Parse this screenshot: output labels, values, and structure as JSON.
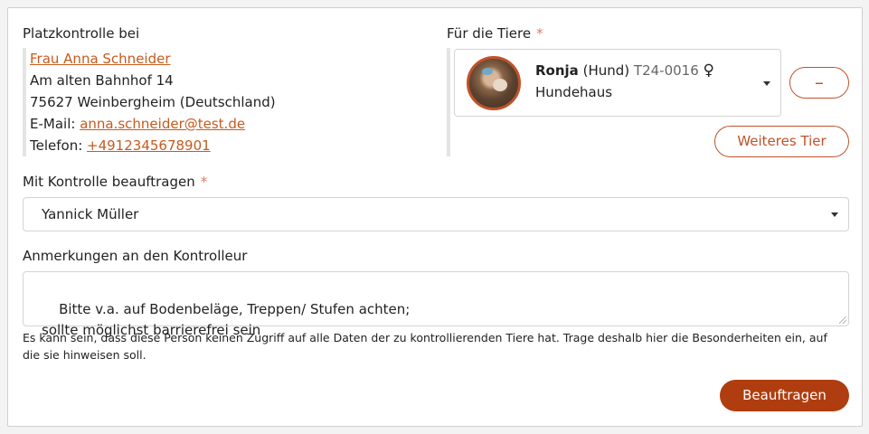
{
  "left": {
    "heading": "Platzkontrolle bei",
    "name": "Frau Anna Schneider",
    "street": "Am alten Bahnhof 14",
    "city": "75627 Weinbergheim (Deutschland)",
    "email_label": "E-Mail: ",
    "email": "anna.schneider@test.de",
    "phone_label": "Telefon: ",
    "phone": "+4912345678901"
  },
  "animals": {
    "heading": "Für die Tiere",
    "required_mark": "*",
    "items": [
      {
        "name": "Ronja",
        "species": "(Hund)",
        "id": "T24-0016",
        "sex_icon": "female-icon",
        "sex_glyph": "♀",
        "location": "Hundehaus"
      }
    ],
    "remove_label": "–",
    "add_label": "Weiteres Tier"
  },
  "assign": {
    "label": "Mit Kontrolle beauftragen",
    "required_mark": "*",
    "value": "Yannick Müller"
  },
  "notes": {
    "label": "Anmerkungen an den Kontrolleur",
    "value": "Bitte v.a. auf Bodenbeläge, Treppen/ Stufen achten;\nsollte möglichst barrierefrei sein",
    "hint": "Es kann sein, dass diese Person keinen Zugriff auf alle Daten der zu kontrollierenden Tiere hat. Trage deshalb hier die Besonderheiten ein, auf die sie hinweisen soll."
  },
  "submit_label": "Beauftragen",
  "colors": {
    "accent": "#c0522b",
    "primary_button": "#b03d0f",
    "link": "#c85a1e"
  }
}
